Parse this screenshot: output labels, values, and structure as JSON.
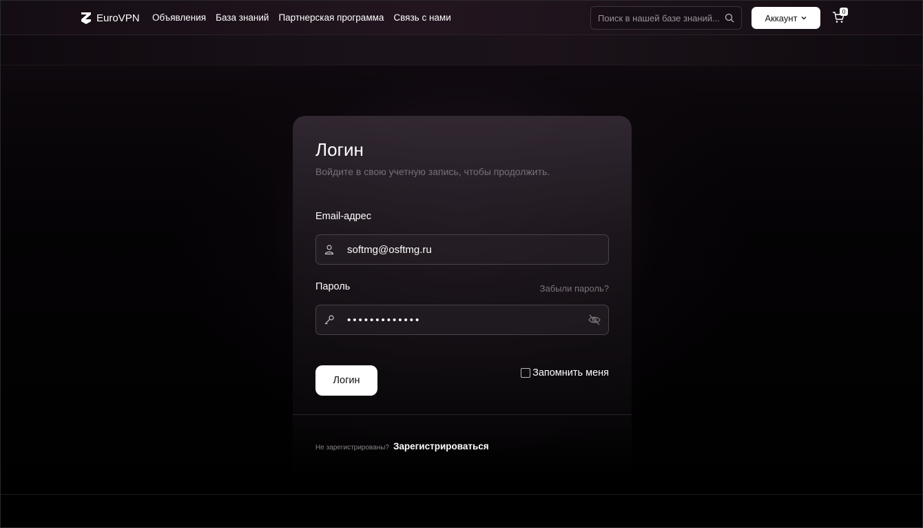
{
  "brand": {
    "name": "EuroVPN"
  },
  "nav": {
    "items": [
      {
        "label": "Объявления"
      },
      {
        "label": "База знаний"
      },
      {
        "label": "Партнерская программа"
      },
      {
        "label": "Связь с нами"
      }
    ]
  },
  "search": {
    "placeholder": "Поиск в нашей базе знаний..."
  },
  "account": {
    "label": "Аккаунт"
  },
  "cart": {
    "count": "0"
  },
  "login": {
    "title": "Логин",
    "subtitle": "Войдите в свою учетную запись, чтобы продолжить.",
    "email_label": "Email-адрес",
    "email_value": "softmg@osftmg.ru",
    "password_label": "Пароль",
    "password_value": "•••••••••••••",
    "forgot_label": "Забыли пароль?",
    "submit_label": "Логин",
    "remember_label": "Запомнить меня",
    "not_registered": "Не зарегистрированы?",
    "register_label": "Зарегистрироваться"
  },
  "colors": {
    "accent_button": "#ffffff",
    "background": "#000000",
    "muted_text": "#77707a"
  }
}
